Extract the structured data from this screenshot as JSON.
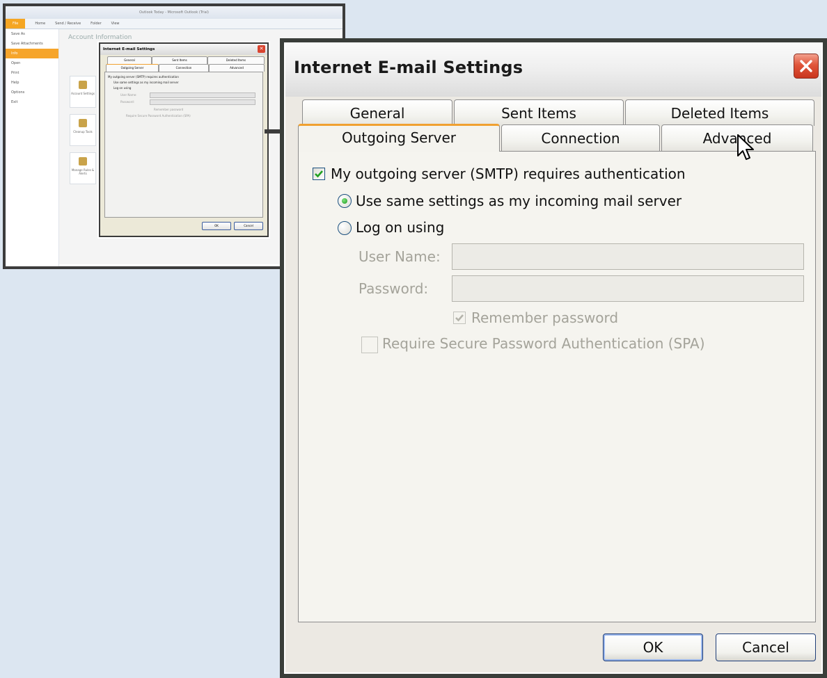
{
  "thumbnail": {
    "window_title": "Outlook Today - Microsoft Outlook (Trial)",
    "ribbon_tabs": [
      "File",
      "Home",
      "Send / Receive",
      "Folder",
      "View"
    ],
    "backstage_items": [
      "Save As",
      "Save Attachments",
      "Info",
      "Open",
      "Print",
      "Help",
      "Options",
      "Exit"
    ],
    "page_heading": "Account Information",
    "tiles": [
      "Account Settings",
      "Cleanup Tools",
      "Manage Rules & Alerts"
    ],
    "dialog": {
      "title": "Internet E-mail Settings",
      "tabs_top": [
        "General",
        "Sent Items",
        "Deleted Items"
      ],
      "tabs_bottom": [
        "Outgoing Server",
        "Connection",
        "Advanced"
      ],
      "lines": [
        "My outgoing server (SMTP) requires authentication",
        "Use same settings as my incoming mail server",
        "Log on using",
        "User Name:",
        "Password:",
        "Remember password",
        "Require Secure Password Authentication (SPA)"
      ],
      "ok": "OK",
      "cancel": "Cancel"
    }
  },
  "dialog": {
    "title": "Internet E-mail Settings",
    "tabs": {
      "general": "General",
      "sent_items": "Sent Items",
      "deleted_items": "Deleted Items",
      "outgoing_server": "Outgoing Server",
      "connection": "Connection",
      "advanced": "Advanced"
    },
    "active_tab": "Outgoing Server",
    "outgoing": {
      "requires_auth_label": "My outgoing server (SMTP) requires authentication",
      "requires_auth_checked": true,
      "use_same_settings_label": "Use same settings as my incoming mail server",
      "use_same_settings_selected": true,
      "log_on_using_label": "Log on using",
      "log_on_using_selected": false,
      "user_name_label": "User Name:",
      "user_name_value": "",
      "password_label": "Password:",
      "password_value": "",
      "remember_password_label": "Remember password",
      "remember_password_checked": true,
      "spa_label": "Require Secure Password Authentication (SPA)",
      "spa_checked": false
    },
    "buttons": {
      "ok": "OK",
      "cancel": "Cancel"
    }
  },
  "colors": {
    "background": "#dce6f1",
    "active_tab_accent": "#f0a030",
    "close_button": "#e0553a",
    "check_mark": "#21a121"
  }
}
